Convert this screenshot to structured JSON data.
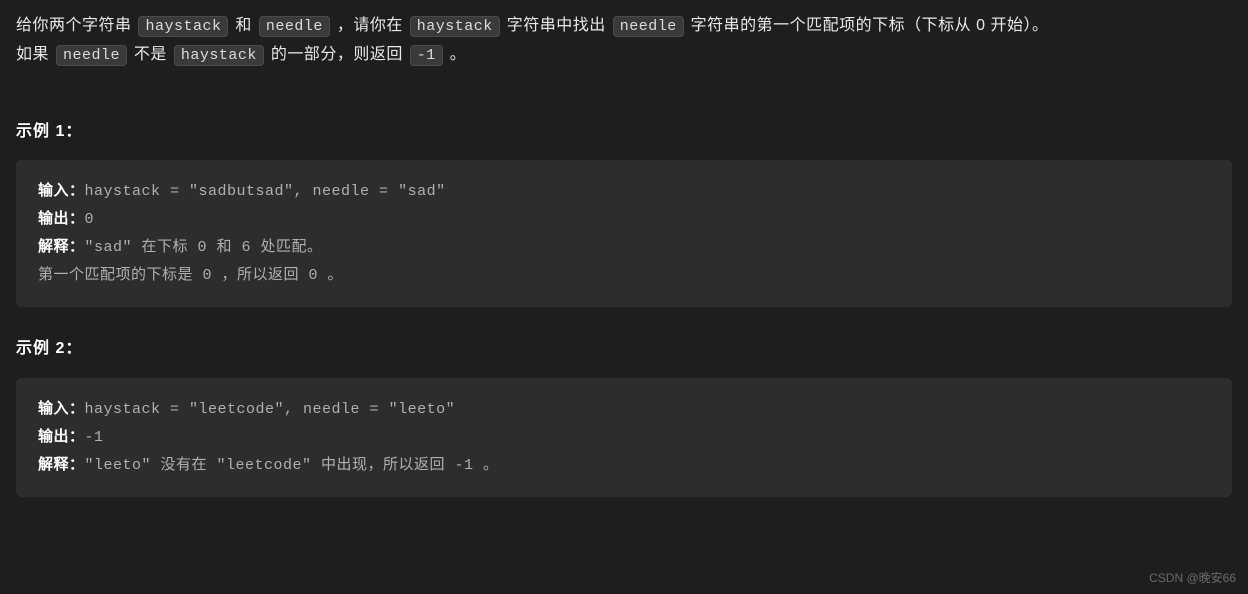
{
  "description": {
    "line1_pre": "给你两个字符串 ",
    "line1_code1": "haystack",
    "line1_mid1": " 和 ",
    "line1_code2": "needle",
    "line1_mid2": " ，请你在 ",
    "line1_code3": "haystack",
    "line1_mid3": " 字符串中找出 ",
    "line1_code4": "needle",
    "line1_post": " 字符串的第一个匹配项的下标（下标从 0 开始）。",
    "line2_pre": "如果 ",
    "line2_code1": "needle",
    "line2_mid1": " 不是 ",
    "line2_code2": "haystack",
    "line2_mid2": " 的一部分，则返回  ",
    "line2_code3": "-1",
    "line2_post": " 。"
  },
  "example1": {
    "title": "示例 1：",
    "input_label": "输入：",
    "input_value": "haystack = \"sadbutsad\", needle = \"sad\"",
    "output_label": "输出：",
    "output_value": "0",
    "explain_label": "解释：",
    "explain_value": "\"sad\" 在下标 0 和 6 处匹配。",
    "explain_line2": "第一个匹配项的下标是 0 ，所以返回 0 。"
  },
  "example2": {
    "title": "示例 2：",
    "input_label": "输入：",
    "input_value": "haystack = \"leetcode\", needle = \"leeto\"",
    "output_label": "输出：",
    "output_value": "-1",
    "explain_label": "解释：",
    "explain_value": "\"leeto\" 没有在 \"leetcode\" 中出现，所以返回 -1 。"
  },
  "watermark": "CSDN @晚安66"
}
